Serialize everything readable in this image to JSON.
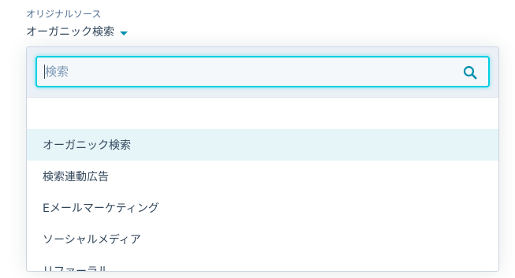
{
  "field": {
    "label": "オリジナルソース",
    "selected_value": "オーガニック検索"
  },
  "search": {
    "placeholder": "検索",
    "value": ""
  },
  "options": [
    {
      "label": "オーガニック検索",
      "selected": true
    },
    {
      "label": "検索連動広告",
      "selected": false
    },
    {
      "label": "Eメールマーケティング",
      "selected": false
    },
    {
      "label": "ソーシャルメディア",
      "selected": false
    },
    {
      "label": "リファーラル",
      "selected": false
    }
  ],
  "colors": {
    "accent": "#0091ae",
    "focus_border": "#00d0e4",
    "selected_bg": "#e5f5f8",
    "text": "#33475b",
    "muted_text": "#516f90"
  },
  "icons": {
    "caret": "caret-down-icon",
    "search": "search-icon"
  }
}
